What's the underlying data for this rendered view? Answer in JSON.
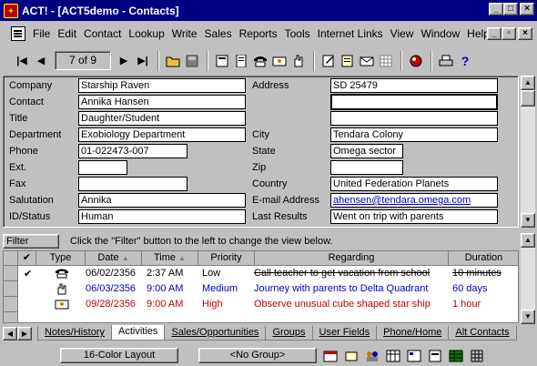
{
  "window": {
    "title": "ACT! - [ACT5demo - Contacts]",
    "controls": [
      "_",
      "□",
      "×"
    ]
  },
  "menu": {
    "items": [
      "File",
      "Edit",
      "Contact",
      "Lookup",
      "Write",
      "Sales",
      "Reports",
      "Tools",
      "Internet Links",
      "View",
      "Window",
      "Help"
    ],
    "doc_controls": [
      "_",
      "▫",
      "×"
    ]
  },
  "toolbar": {
    "record_indicator": "7 of 9",
    "nav_first": "|◀",
    "nav_prev": "◀",
    "nav_next": "▶",
    "nav_last": "▶|",
    "help": "?"
  },
  "contact": {
    "labels": {
      "company": "Company",
      "contact": "Contact",
      "title": "Title",
      "department": "Department",
      "phone": "Phone",
      "ext": "Ext.",
      "fax": "Fax",
      "salutation": "Salutation",
      "id_status": "ID/Status",
      "address": "Address",
      "city": "City",
      "state": "State",
      "zip": "Zip",
      "country": "Country",
      "email": "E-mail Address",
      "last_results": "Last Results"
    },
    "values": {
      "company": "Starship Raven",
      "contact": "Annika Hansen",
      "title": "Daughter/Student",
      "department": "Exobiology Department",
      "phone": "01-022473-007",
      "ext": "",
      "fax": "",
      "salutation": "Annika",
      "id_status": "Human",
      "address1": "SD 25479",
      "address2": "",
      "address3": "",
      "city": "Tendara Colony",
      "state": "Omega sector",
      "zip": "",
      "country": "United Federation Planets",
      "email": "ahensen@tendara.omega.com",
      "last_results": "Went on trip with parents"
    }
  },
  "filter": {
    "button_label": "Filter",
    "hint": "Click the \"Filter\" button to the left to change the view below."
  },
  "activities": {
    "columns": [
      "",
      "Type",
      "Date",
      "Time",
      "Priority",
      "Regarding",
      "Duration"
    ],
    "rows": [
      {
        "check": "✔",
        "date": "06/02/2356",
        "time": "2:37 AM",
        "priority": "Low",
        "regarding": "Call teacher to get vacation from school",
        "duration": "10 minutes",
        "color": "#000000",
        "type_icon": "phone-icon"
      },
      {
        "check": "",
        "date": "06/03/2356",
        "time": "9:00 AM",
        "priority": "Medium",
        "regarding": "Journey with parents to Delta Quadrant",
        "duration": "60 days",
        "color": "#0000c0",
        "type_icon": "todo-icon"
      },
      {
        "check": "",
        "date": "09/28/2356",
        "time": "9:00 AM",
        "priority": "High",
        "regarding": "Observe unusual cube shaped star ship",
        "duration": "1 hour",
        "color": "#c00000",
        "type_icon": "meeting-icon"
      }
    ]
  },
  "tabs": [
    "Notes/History",
    "Activities",
    "Sales/Opportunities",
    "Groups",
    "User Fields",
    "Phone/Home",
    "Alt Contacts"
  ],
  "active_tab": "Activities",
  "status": {
    "layout": "16-Color Layout",
    "group": "<No Group>"
  }
}
